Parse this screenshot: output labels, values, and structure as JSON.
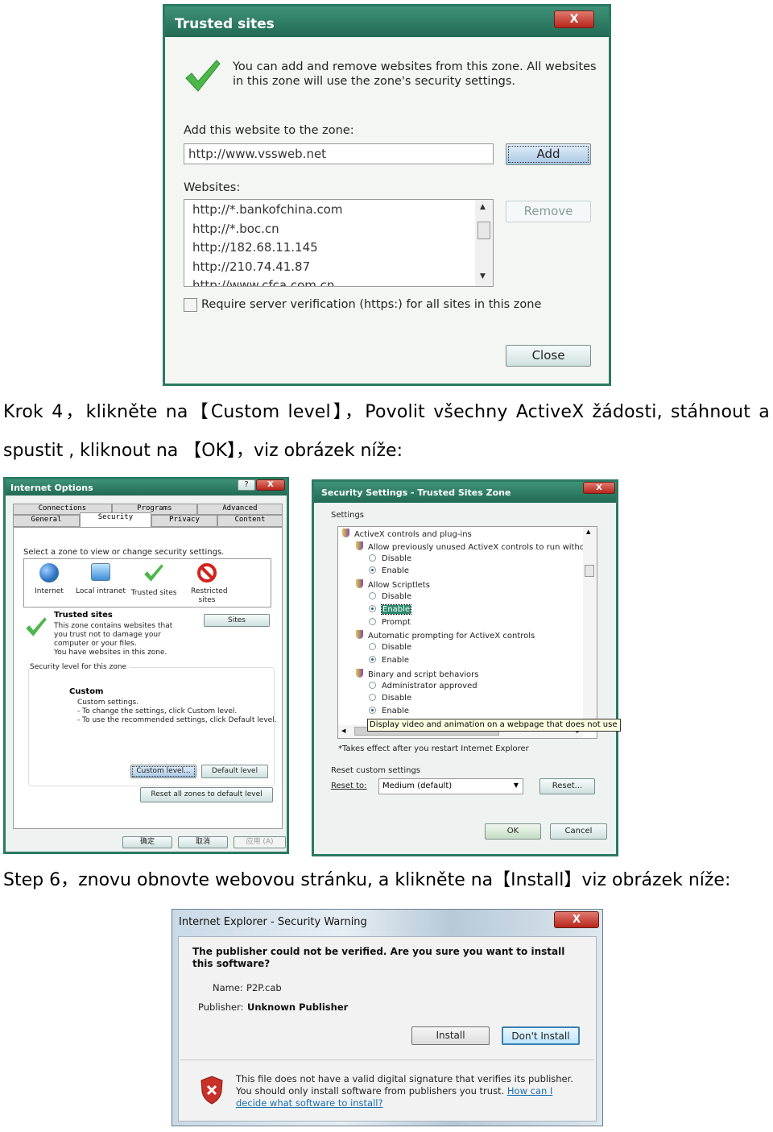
{
  "trusted_sites": {
    "title": "Trusted sites",
    "close_glyph": "X",
    "intro": "You can add and remove websites from this zone. All websites in this zone will use the zone's security settings.",
    "add_label": "Add this website to the zone:",
    "add_value": "http://www.vssweb.net",
    "add_button": "Add",
    "websites_label": "Websites:",
    "websites": [
      "http://*.bankofchina.com",
      "http://*.boc.cn",
      "http://182.68.11.145",
      "http://210.74.41.87",
      "http://www.cfca.com.cn"
    ],
    "remove_button": "Remove",
    "https_checkbox": "Require server verification (https:) for all sites in this zone",
    "https_checked": false,
    "close_button": "Close"
  },
  "text": {
    "step4_line1": "Krok 4，klikněte na【Custom level】，Povolit všechny ActiveX žádosti, stáhnout a",
    "step4_line2": "spustit , kliknout na 【OK】，viz obrázek níže:",
    "step6": "Step 6，znovu obnovte webovou stránku, a klikněte na【Install】viz obrázek níže:"
  },
  "internet_options": {
    "title": "Internet Options",
    "help_glyph": "?",
    "close_glyph": "X",
    "tabs_row1": [
      "Connections",
      "Programs",
      "Advanced"
    ],
    "tabs_row2": [
      "General",
      "Security",
      "Privacy",
      "Content"
    ],
    "active_tab": "Security",
    "zone_prompt": "Select a zone to view or change security settings.",
    "zones": [
      {
        "label": "Internet",
        "icon": "globe-icon"
      },
      {
        "label": "Local intranet",
        "icon": "intranet-icon"
      },
      {
        "label": "Trusted sites",
        "icon": "checkmark-icon"
      },
      {
        "label": "Restricted sites",
        "icon": "restricted-icon"
      }
    ],
    "zone_title": "Trusted sites",
    "zone_desc": "This zone contains websites that you trust not to damage your computer or your files.",
    "zone_note": "You have websites in this zone.",
    "sites_button": "Sites",
    "level_group": "Security level for this zone",
    "level_name": "Custom",
    "level_lines": [
      "Custom settings.",
      "- To change the settings, click Custom level.",
      "- To use the recommended settings, click Default level."
    ],
    "custom_level_button": "Custom level...",
    "default_level_button": "Default level",
    "reset_all_button": "Reset all zones to default level",
    "ok_button": "确定",
    "cancel_button": "取消",
    "apply_button": "应用 (A)"
  },
  "security_settings": {
    "title": "Security Settings - Trusted Sites Zone",
    "close_glyph": "X",
    "settings_label": "Settings",
    "items": [
      {
        "type": "header",
        "label": "ActiveX controls and plug-ins"
      },
      {
        "type": "setting",
        "label": "Allow previously unused ActiveX controls to run without prom"
      },
      {
        "type": "radio",
        "label": "Disable",
        "checked": false
      },
      {
        "type": "radio",
        "label": "Enable",
        "checked": true
      },
      {
        "type": "setting",
        "label": "Allow Scriptlets"
      },
      {
        "type": "radio",
        "label": "Disable",
        "checked": false
      },
      {
        "type": "radio",
        "label": "Enable",
        "checked": true,
        "selected": true
      },
      {
        "type": "radio",
        "label": "Prompt",
        "checked": false
      },
      {
        "type": "setting",
        "label": "Automatic prompting for ActiveX controls"
      },
      {
        "type": "radio",
        "label": "Disable",
        "checked": false
      },
      {
        "type": "radio",
        "label": "Enable",
        "checked": true
      },
      {
        "type": "setting",
        "label": "Binary and script behaviors"
      },
      {
        "type": "radio",
        "label": "Administrator approved",
        "checked": false
      },
      {
        "type": "radio",
        "label": "Disable",
        "checked": false
      },
      {
        "type": "radio",
        "label": "Enable",
        "checked": true
      }
    ],
    "tooltip": "Display video and animation on a webpage that does not use external r",
    "restart_note": "*Takes effect after you restart Internet Explorer",
    "reset_group": "Reset custom settings",
    "reset_to_label": "Reset to:",
    "reset_to_value": "Medium (default)",
    "reset_button": "Reset...",
    "ok_button": "OK",
    "cancel_button": "Cancel"
  },
  "security_warning": {
    "title": "Internet Explorer - Security Warning",
    "close_glyph": "X",
    "question": "The publisher could not be verified.  Are you sure you want to install this software?",
    "name_label": "Name:",
    "name_value": "P2P.cab",
    "publisher_label": "Publisher:",
    "publisher_value": "Unknown Publisher",
    "install_button": "Install",
    "dont_install_button": "Don't Install",
    "warning_text": "This file does not have a valid digital signature that verifies its publisher. You should only install software from publishers you trust.",
    "help_link": "How can I decide what software to install?",
    "link_color": "#1a6fb0"
  }
}
